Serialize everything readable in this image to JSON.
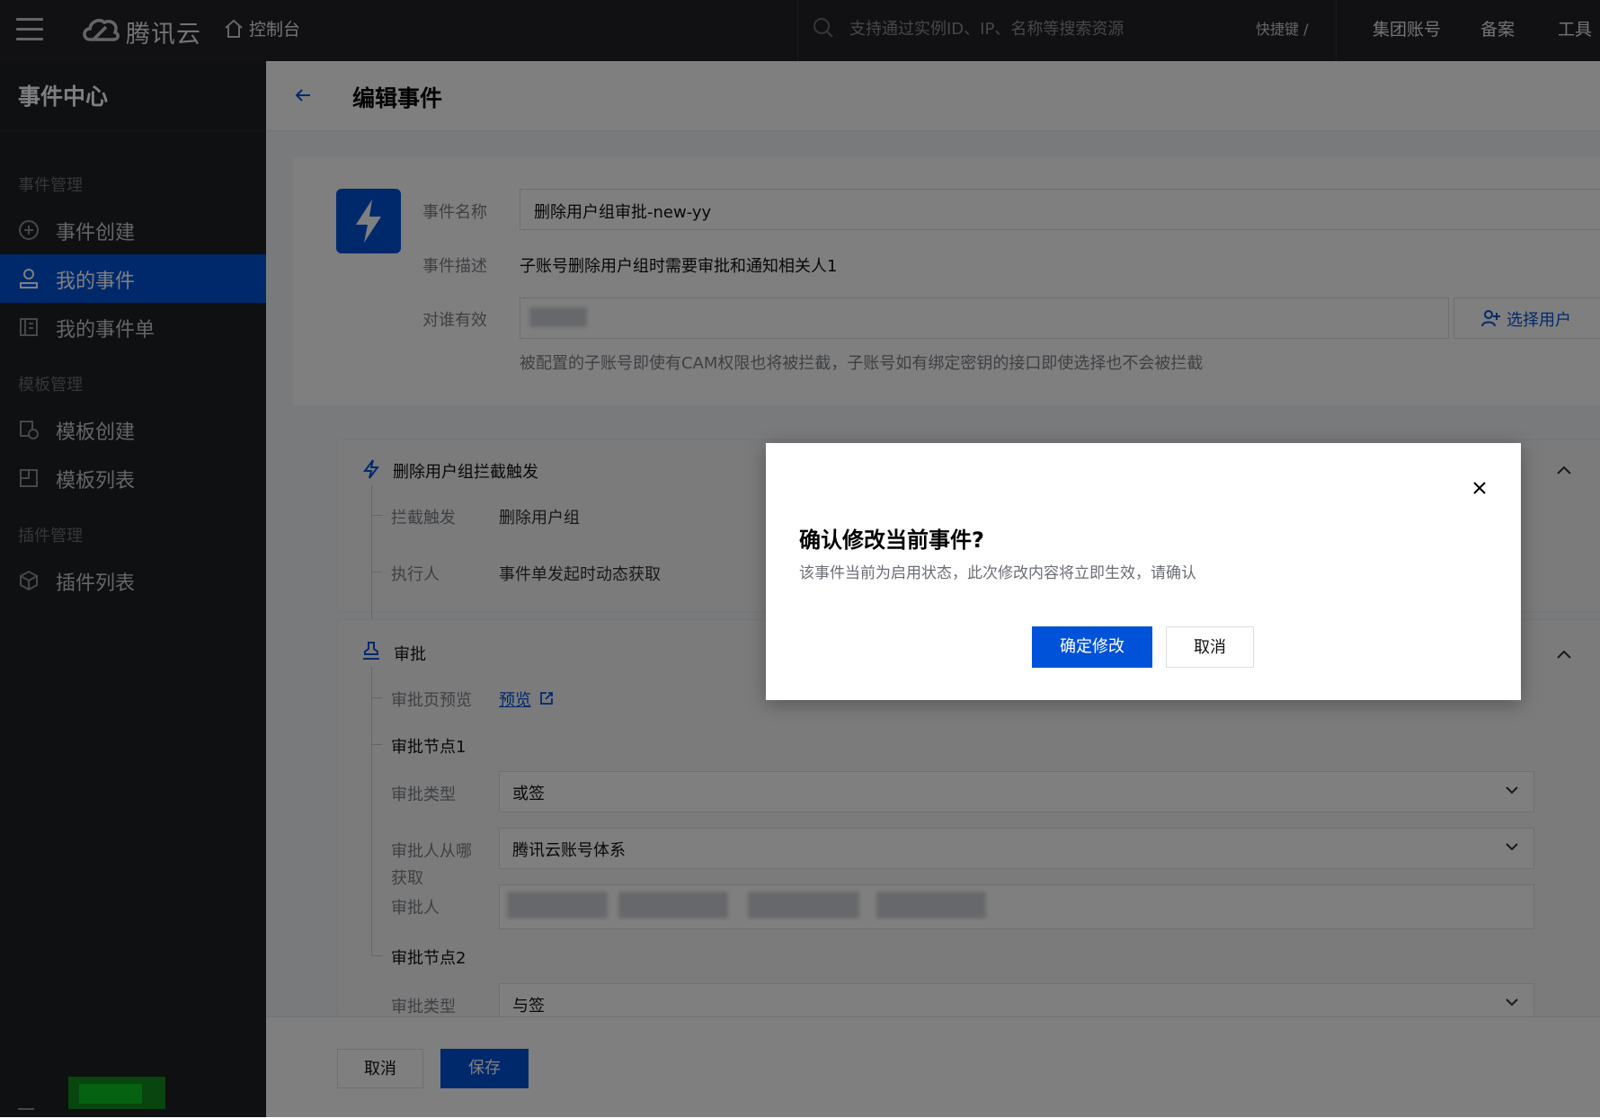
{
  "topbar": {
    "brand": "腾讯云",
    "console": "控制台",
    "search_placeholder": "支持通过实例ID、IP、名称等搜索资源",
    "hotkey": "快捷键 /",
    "nav": [
      "集团账号",
      "备案",
      "工具"
    ]
  },
  "sidebar": {
    "title": "事件中心",
    "groups": {
      "event_mgmt": "事件管理",
      "template_mgmt": "模板管理",
      "plugin_mgmt": "插件管理"
    },
    "items": [
      {
        "label": "事件创建",
        "icon": "plus-circle-icon"
      },
      {
        "label": "我的事件",
        "icon": "user-icon",
        "active": true
      },
      {
        "label": "我的事件单",
        "icon": "document-icon"
      },
      {
        "label": "模板创建",
        "icon": "template-add-icon"
      },
      {
        "label": "模板列表",
        "icon": "template-list-icon"
      },
      {
        "label": "插件列表",
        "icon": "cube-icon"
      }
    ]
  },
  "page": {
    "title": "编辑事件",
    "form": {
      "name_label": "事件名称",
      "name_value": "删除用户组审批-new-yy",
      "desc_label": "事件描述",
      "desc_value": "子账号删除用户组时需要审批和通知相关人1",
      "target_label": "对谁有效",
      "select_user": "选择用户",
      "hint": "被配置的子账号即使有CAM权限也将被拦截，子账号如有绑定密钥的接口即使选择也不会被拦截"
    },
    "trigger": {
      "title": "删除用户组拦截触发",
      "intercept_label": "拦截触发",
      "intercept_value": "删除用户组",
      "executor_label": "执行人",
      "executor_value": "事件单发起时动态获取"
    },
    "approval": {
      "title": "审批",
      "preview_label": "审批页预览",
      "preview_link": "预览",
      "node1_title": "审批节点1",
      "type_label": "审批类型",
      "node1_type": "或签",
      "source_label_1": "审批人从哪",
      "source_label_2": "获取",
      "source_value": "腾讯云账号体系",
      "approver_label": "审批人",
      "node2_title": "审批节点2",
      "node2_type": "与签"
    },
    "footer": {
      "cancel": "取消",
      "save": "保存"
    }
  },
  "modal": {
    "title": "确认修改当前事件?",
    "desc": "该事件当前为启用状态，此次修改内容将立即生效，请确认",
    "confirm": "确定修改",
    "cancel": "取消"
  },
  "colors": {
    "brand": "#0052d9",
    "sidebar_bg": "#1f2024",
    "topbar_bg": "#222327"
  }
}
